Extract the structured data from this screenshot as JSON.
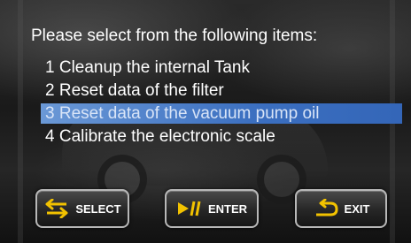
{
  "prompt": "Please select from the following items:",
  "menu": {
    "items": [
      {
        "label": "1 Cleanup the internal Tank",
        "selected": false
      },
      {
        "label": "2 Reset data of the filter",
        "selected": false
      },
      {
        "label": "3 Reset data of the vacuum pump oil",
        "selected": true
      },
      {
        "label": "4 Calibrate the electronic scale",
        "selected": false
      }
    ]
  },
  "buttons": {
    "select": {
      "label": "SELECT",
      "icon": "swap-arrows-icon"
    },
    "enter": {
      "label": "ENTER",
      "icon": "play-pause-icon"
    },
    "exit": {
      "label": "EXIT",
      "icon": "return-arrow-icon"
    }
  },
  "colors": {
    "accent_yellow": "#f2c200",
    "selection_blue": "#3b6fc0"
  }
}
